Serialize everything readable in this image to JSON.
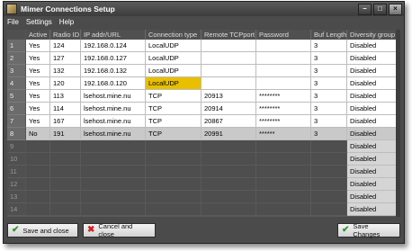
{
  "window": {
    "title": "Mimer Connections Setup"
  },
  "menu": [
    "File",
    "Settings",
    "Help"
  ],
  "columns": [
    "Active",
    "Radio ID",
    "IP addr/URL",
    "Connection type",
    "Remote TCPport",
    "Password",
    "Buf Length",
    "Diversity group"
  ],
  "rows": [
    {
      "n": "1",
      "cells": [
        "Yes",
        "124",
        "192.168.0.124",
        "LocalUDP",
        "",
        "",
        "3",
        "Disabled"
      ]
    },
    {
      "n": "2",
      "cells": [
        "Yes",
        "127",
        "192.168.0.127",
        "LocalUDP",
        "",
        "",
        "3",
        "Disabled"
      ]
    },
    {
      "n": "3",
      "cells": [
        "Yes",
        "132",
        "192.168.0.132",
        "LocalUDP",
        "",
        "",
        "3",
        "Disabled"
      ]
    },
    {
      "n": "4",
      "cells": [
        "Yes",
        "120",
        "192.168.0.120",
        "LocalUDP",
        "",
        "",
        "3",
        "Disabled"
      ]
    },
    {
      "n": "5",
      "cells": [
        "Yes",
        "113",
        "lsehost.mine.nu",
        "TCP",
        "20913",
        "********",
        "3",
        "Disabled"
      ]
    },
    {
      "n": "6",
      "cells": [
        "Yes",
        "114",
        "lsehost.mine.nu",
        "TCP",
        "20914",
        "********",
        "3",
        "Disabled"
      ]
    },
    {
      "n": "7",
      "cells": [
        "Yes",
        "167",
        "lsehost.mine.nu",
        "TCP",
        "20867",
        "********",
        "3",
        "Disabled"
      ]
    },
    {
      "n": "8",
      "cells": [
        "No",
        "191",
        "lsehost.mine.nu",
        "TCP",
        "20991",
        "******",
        "3",
        "Disabled"
      ]
    }
  ],
  "empty_rows": [
    {
      "n": "9",
      "div": "Disabled"
    },
    {
      "n": "10",
      "div": "Disabled"
    },
    {
      "n": "11",
      "div": "Disabled"
    },
    {
      "n": "12",
      "div": "Disabled"
    },
    {
      "n": "13",
      "div": "Disabled"
    },
    {
      "n": "14",
      "div": "Disabled"
    }
  ],
  "buttons": {
    "save_close": "Save and close",
    "cancel_close": "Cancel and close",
    "save_changes": "Save Changes"
  },
  "colors": {
    "highlight": "#e8c000",
    "save_icon": "#2b9a2b",
    "cancel_icon": "#d42020"
  },
  "icons": {
    "save": "check-icon",
    "cancel": "cross-icon",
    "save_changes": "check-icon"
  }
}
